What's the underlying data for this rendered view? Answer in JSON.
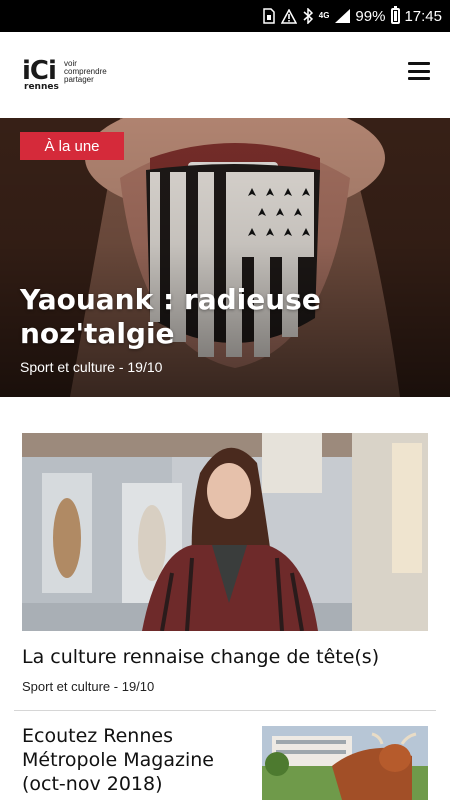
{
  "status_bar": {
    "network": "4G",
    "battery_percent": "99%",
    "time": "17:45",
    "icons": [
      "sim-icon",
      "alert-icon",
      "bluetooth-icon",
      "network-4g-icon",
      "signal-icon",
      "battery-icon"
    ]
  },
  "header": {
    "logo": {
      "main": "iCi",
      "city": "rennes",
      "tagline": [
        "voir",
        "comprendre",
        "partager"
      ]
    },
    "menu_icon": "hamburger-menu-icon"
  },
  "hero": {
    "badge": "À la une",
    "title": "Yaouank : radieuse noz'talgie",
    "meta": "Sport et culture - 19/10",
    "badge_color": "#d52a3a"
  },
  "articles": [
    {
      "title": "La culture rennaise change de tête(s)",
      "meta": "Sport et culture - 19/10"
    },
    {
      "title": "Ecoutez Rennes Métropole Magazine (oct-nov 2018)"
    }
  ]
}
